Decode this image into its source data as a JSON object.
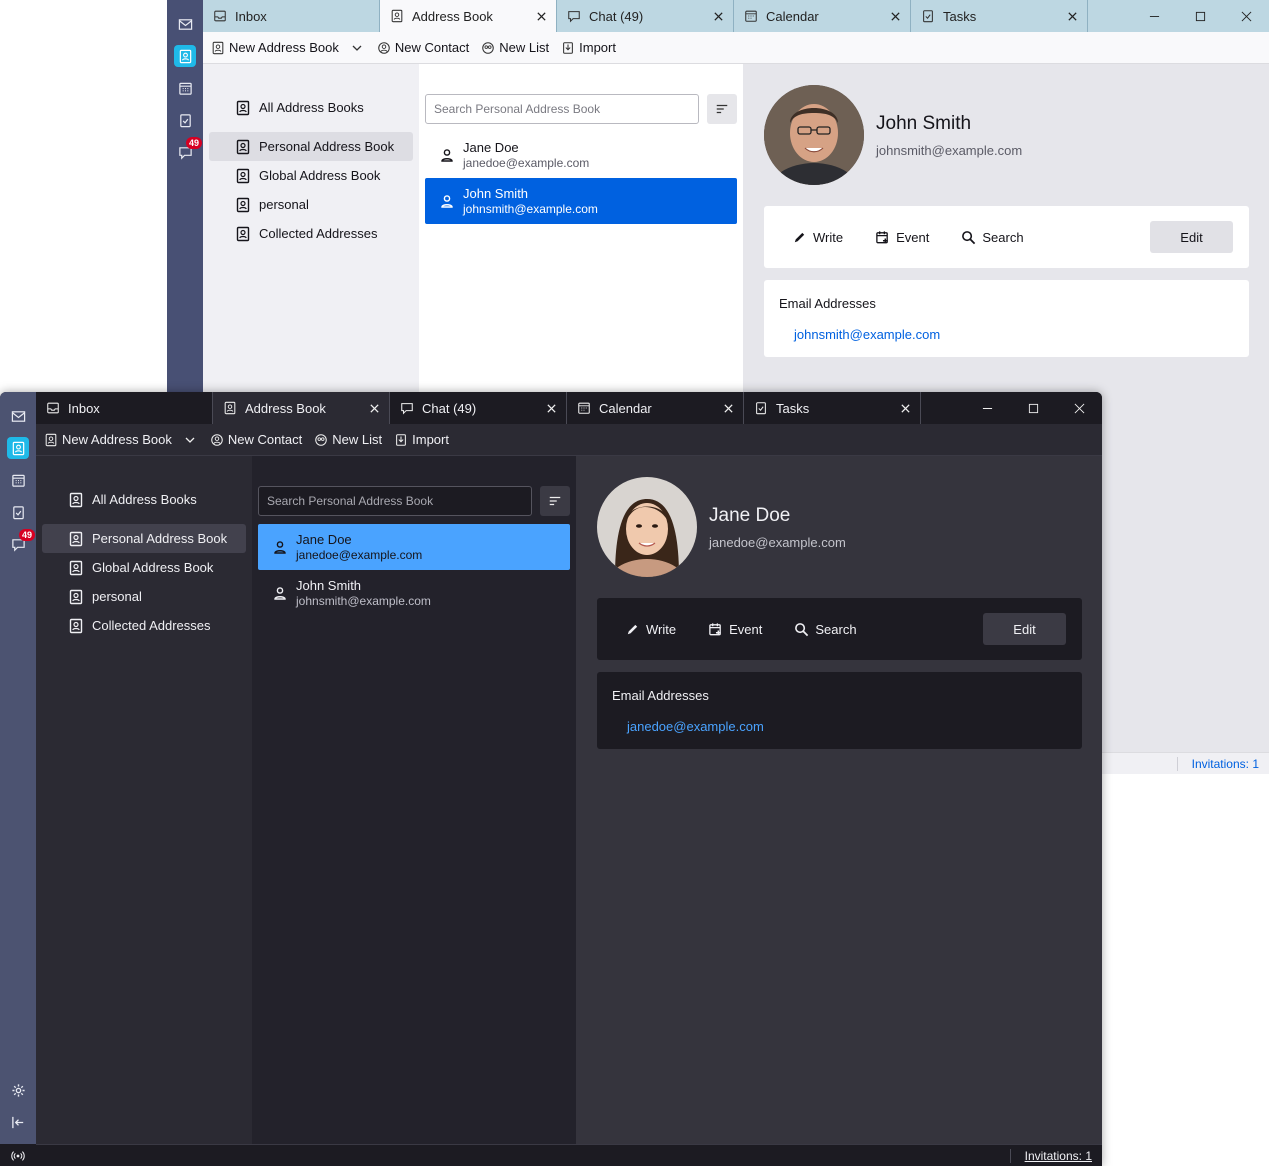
{
  "tabs": [
    {
      "label": "Inbox",
      "icon": "inbox-icon"
    },
    {
      "label": "Address Book",
      "icon": "address-book-icon"
    },
    {
      "label": "Chat (49)",
      "icon": "chat-icon"
    },
    {
      "label": "Calendar",
      "icon": "calendar-icon"
    },
    {
      "label": "Tasks",
      "icon": "tasks-icon"
    }
  ],
  "spaces": {
    "chat_badge": "49"
  },
  "toolbar": {
    "new_address_book": "New Address Book",
    "new_contact": "New Contact",
    "new_list": "New List",
    "import": "Import"
  },
  "books": [
    "All Address Books",
    "Personal Address Book",
    "Global Address Book",
    "personal",
    "Collected Addresses"
  ],
  "search": {
    "placeholder": "Search Personal Address Book"
  },
  "cards": [
    {
      "name": "Jane Doe",
      "email": "janedoe@example.com"
    },
    {
      "name": "John Smith",
      "email": "johnsmith@example.com"
    }
  ],
  "actions": {
    "write": "Write",
    "event": "Event",
    "search": "Search",
    "edit": "Edit"
  },
  "emails_title": "Email Addresses",
  "status": {
    "invitations": "Invitations: 1"
  },
  "light": {
    "selected_card": "John Smith",
    "detail": {
      "name": "John Smith",
      "email": "johnsmith@example.com"
    }
  },
  "dark": {
    "selected_card": "Jane Doe",
    "detail": {
      "name": "Jane Doe",
      "email": "janedoe@example.com"
    }
  },
  "colors": {
    "accent_light": "#0061e0",
    "accent_dark": "#4aa3ff",
    "space_active": "#1fb9e8",
    "badge": "#d70022",
    "tabbar_light": "#bdd7e2"
  }
}
